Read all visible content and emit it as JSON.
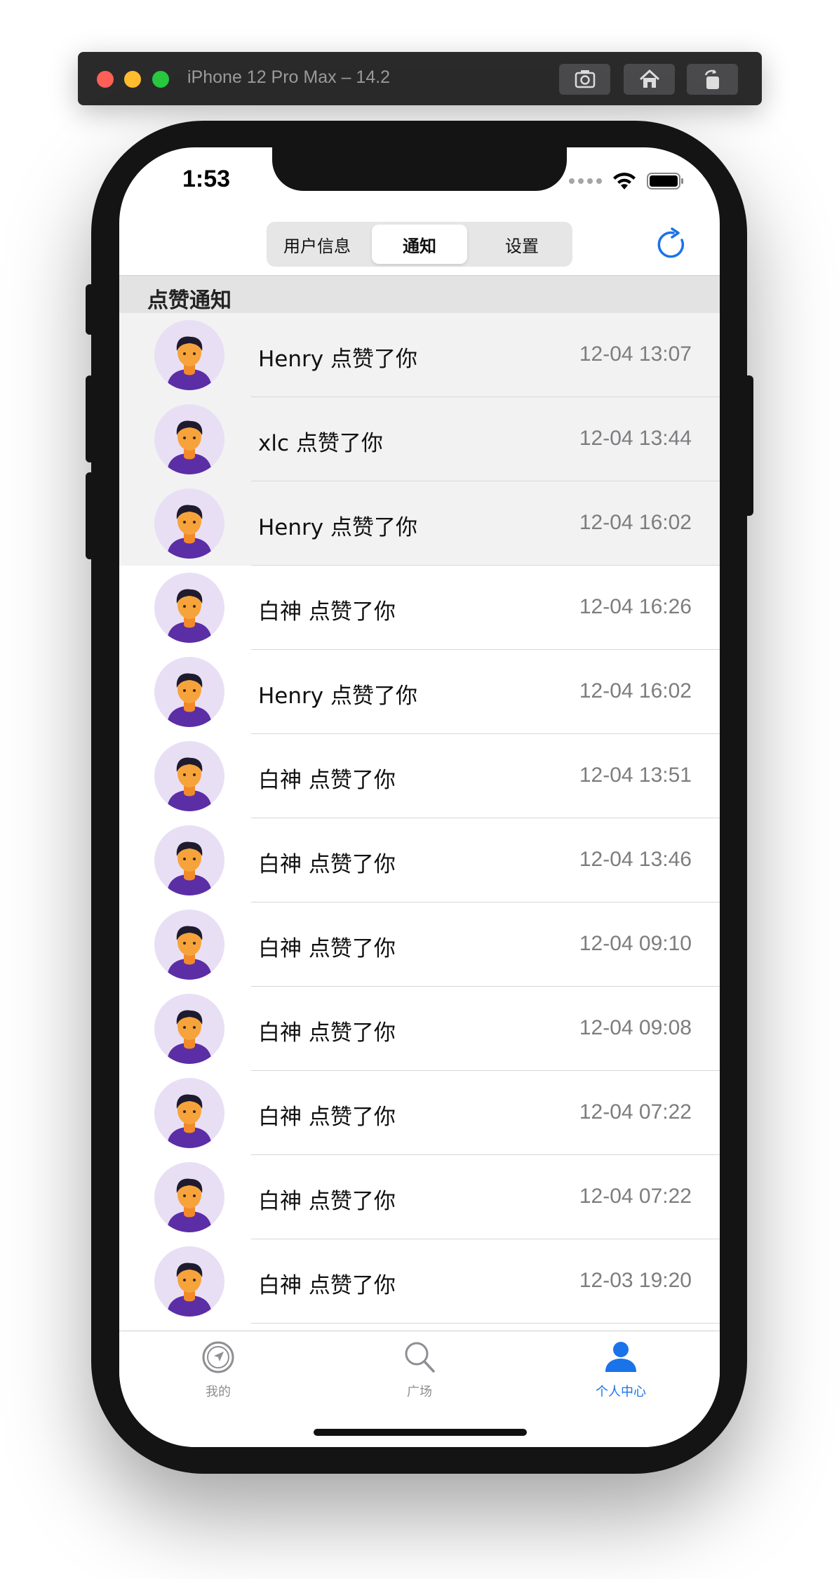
{
  "simulator": {
    "title": "iPhone 12 Pro Max – 14.2",
    "buttons": [
      "screenshot-icon",
      "home-icon",
      "rotate-icon"
    ]
  },
  "status_bar": {
    "time": "1:53"
  },
  "segmented": {
    "items": [
      "用户信息",
      "通知",
      "设置"
    ],
    "selected": "通知"
  },
  "section": {
    "title": "点赞通知"
  },
  "notifications": [
    {
      "text": "Henry 点赞了你",
      "time": "12-04 13:07"
    },
    {
      "text": "xlc 点赞了你",
      "time": "12-04 13:44"
    },
    {
      "text": "Henry 点赞了你",
      "time": "12-04 16:02"
    },
    {
      "text": "白神 点赞了你",
      "time": "12-04 16:26"
    },
    {
      "text": "Henry 点赞了你",
      "time": "12-04 16:02"
    },
    {
      "text": "白神 点赞了你",
      "time": "12-04 13:51"
    },
    {
      "text": "白神 点赞了你",
      "time": "12-04 13:46"
    },
    {
      "text": "白神 点赞了你",
      "time": "12-04 09:10"
    },
    {
      "text": "白神 点赞了你",
      "time": "12-04 09:08"
    },
    {
      "text": "白神 点赞了你",
      "time": "12-04 07:22"
    },
    {
      "text": "白神 点赞了你",
      "time": "12-04 07:22"
    },
    {
      "text": "白神 点赞了你",
      "time": "12-03 19:20"
    }
  ],
  "tabbar": {
    "items": [
      {
        "label": "我的",
        "icon": "compass-icon"
      },
      {
        "label": "广场",
        "icon": "search-icon"
      },
      {
        "label": "个人中心",
        "icon": "person-icon",
        "active": true
      }
    ],
    "active_color": "#1a73e8"
  }
}
